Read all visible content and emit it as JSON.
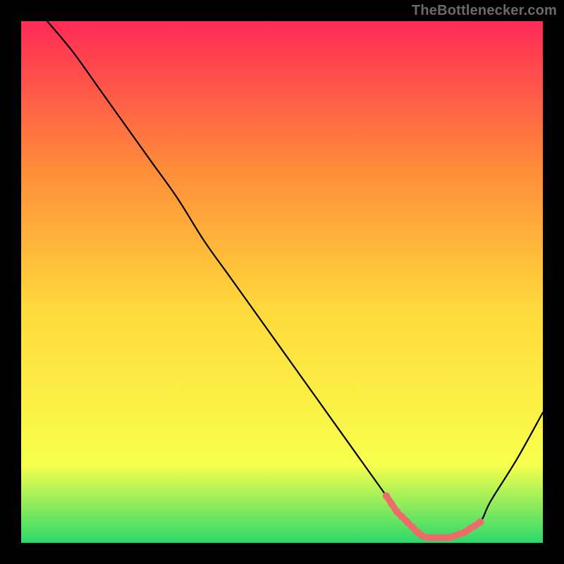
{
  "watermark": "TheBottlenecker.com",
  "chart_data": {
    "type": "line",
    "title": "",
    "xlabel": "",
    "ylabel": "",
    "xlim": [
      0,
      100
    ],
    "ylim": [
      0,
      100
    ],
    "grid": false,
    "legend": false,
    "background": "rainbow-vertical-gradient",
    "background_colors": {
      "top": "#ff2a55",
      "mid_upper": "#ff8b3a",
      "mid": "#ffd93b",
      "mid_lower": "#f8ff4d",
      "bottom": "#2bd96a"
    },
    "series": [
      {
        "name": "bottleneck-curve",
        "color": "#000000",
        "x": [
          5,
          10,
          15,
          20,
          25,
          30,
          35,
          40,
          45,
          50,
          55,
          60,
          65,
          70,
          72,
          75,
          78,
          80,
          82,
          85,
          88,
          90,
          95,
          100
        ],
        "y": [
          100,
          94,
          87,
          80,
          73,
          66,
          58,
          51,
          44,
          37,
          30,
          23,
          16,
          9,
          6,
          3,
          1,
          1,
          1,
          2,
          4,
          8,
          16,
          25
        ]
      }
    ],
    "highlight_region": {
      "color": "#ee6b6b",
      "x": [
        70,
        71,
        72,
        73,
        74,
        75,
        76,
        77,
        78,
        79,
        80,
        81,
        82,
        83,
        84,
        85,
        86,
        87,
        88
      ],
      "y": [
        9,
        7.5,
        6,
        5,
        4,
        3,
        2,
        1.3,
        1,
        1,
        1,
        1,
        1,
        1.3,
        1.7,
        2,
        2.7,
        3.3,
        4
      ]
    }
  }
}
